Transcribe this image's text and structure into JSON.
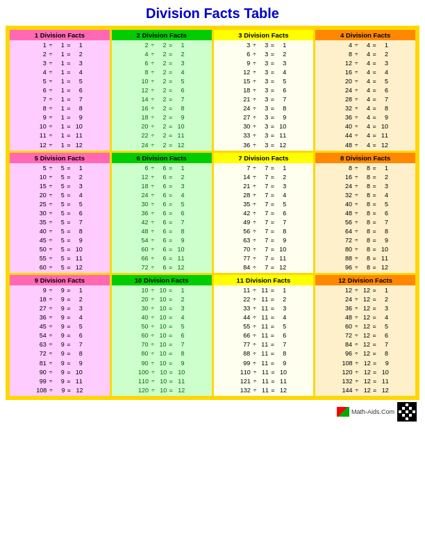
{
  "title": "Division Facts Table",
  "sections": [
    {
      "id": 1,
      "label": "1 Division Facts",
      "class": "s1",
      "divisor": 1,
      "facts": [
        [
          1,
          1,
          1
        ],
        [
          2,
          1,
          2
        ],
        [
          3,
          1,
          3
        ],
        [
          4,
          1,
          4
        ],
        [
          5,
          1,
          5
        ],
        [
          6,
          1,
          6
        ],
        [
          7,
          1,
          7
        ],
        [
          8,
          1,
          8
        ],
        [
          9,
          1,
          9
        ],
        [
          10,
          1,
          10
        ],
        [
          11,
          1,
          11
        ],
        [
          12,
          1,
          12
        ]
      ]
    },
    {
      "id": 2,
      "label": "2 Division Facts",
      "class": "s2",
      "divisor": 2,
      "facts": [
        [
          2,
          2,
          1
        ],
        [
          4,
          2,
          2
        ],
        [
          6,
          2,
          3
        ],
        [
          8,
          2,
          4
        ],
        [
          10,
          2,
          5
        ],
        [
          12,
          2,
          6
        ],
        [
          14,
          2,
          7
        ],
        [
          16,
          2,
          8
        ],
        [
          18,
          2,
          9
        ],
        [
          20,
          2,
          10
        ],
        [
          22,
          2,
          11
        ],
        [
          24,
          2,
          12
        ]
      ]
    },
    {
      "id": 3,
      "label": "3 Division Facts",
      "class": "s3",
      "divisor": 3,
      "facts": [
        [
          3,
          3,
          1
        ],
        [
          6,
          3,
          2
        ],
        [
          9,
          3,
          3
        ],
        [
          12,
          3,
          4
        ],
        [
          15,
          3,
          5
        ],
        [
          18,
          3,
          6
        ],
        [
          21,
          3,
          7
        ],
        [
          24,
          3,
          8
        ],
        [
          27,
          3,
          9
        ],
        [
          30,
          3,
          10
        ],
        [
          33,
          3,
          11
        ],
        [
          36,
          3,
          12
        ]
      ]
    },
    {
      "id": 4,
      "label": "4 Division Facts",
      "class": "s4",
      "divisor": 4,
      "facts": [
        [
          4,
          4,
          1
        ],
        [
          8,
          4,
          2
        ],
        [
          12,
          4,
          3
        ],
        [
          16,
          4,
          4
        ],
        [
          20,
          4,
          5
        ],
        [
          24,
          4,
          6
        ],
        [
          28,
          4,
          7
        ],
        [
          32,
          4,
          8
        ],
        [
          36,
          4,
          9
        ],
        [
          40,
          4,
          10
        ],
        [
          44,
          4,
          11
        ],
        [
          48,
          4,
          12
        ]
      ]
    },
    {
      "id": 5,
      "label": "5 Division Facts",
      "class": "s5",
      "divisor": 5,
      "facts": [
        [
          5,
          5,
          1
        ],
        [
          10,
          5,
          2
        ],
        [
          15,
          5,
          3
        ],
        [
          20,
          5,
          4
        ],
        [
          25,
          5,
          5
        ],
        [
          30,
          5,
          6
        ],
        [
          35,
          5,
          7
        ],
        [
          40,
          5,
          8
        ],
        [
          45,
          5,
          9
        ],
        [
          50,
          5,
          10
        ],
        [
          55,
          5,
          11
        ],
        [
          60,
          5,
          12
        ]
      ]
    },
    {
      "id": 6,
      "label": "6 Division Facts",
      "class": "s6",
      "divisor": 6,
      "facts": [
        [
          6,
          6,
          1
        ],
        [
          12,
          6,
          2
        ],
        [
          18,
          6,
          3
        ],
        [
          24,
          6,
          4
        ],
        [
          30,
          6,
          5
        ],
        [
          36,
          6,
          6
        ],
        [
          42,
          6,
          7
        ],
        [
          48,
          6,
          8
        ],
        [
          54,
          6,
          9
        ],
        [
          60,
          6,
          10
        ],
        [
          66,
          6,
          11
        ],
        [
          72,
          6,
          12
        ]
      ]
    },
    {
      "id": 7,
      "label": "7 Division Facts",
      "class": "s7",
      "divisor": 7,
      "facts": [
        [
          7,
          7,
          1
        ],
        [
          14,
          7,
          2
        ],
        [
          21,
          7,
          3
        ],
        [
          28,
          7,
          4
        ],
        [
          35,
          7,
          5
        ],
        [
          42,
          7,
          6
        ],
        [
          49,
          7,
          7
        ],
        [
          56,
          7,
          8
        ],
        [
          63,
          7,
          9
        ],
        [
          70,
          7,
          10
        ],
        [
          77,
          7,
          11
        ],
        [
          84,
          7,
          12
        ]
      ]
    },
    {
      "id": 8,
      "label": "8 Division Facts",
      "class": "s8",
      "divisor": 8,
      "facts": [
        [
          8,
          8,
          1
        ],
        [
          16,
          8,
          2
        ],
        [
          24,
          8,
          3
        ],
        [
          32,
          8,
          4
        ],
        [
          40,
          8,
          5
        ],
        [
          48,
          8,
          6
        ],
        [
          56,
          8,
          7
        ],
        [
          64,
          8,
          8
        ],
        [
          72,
          8,
          9
        ],
        [
          80,
          8,
          10
        ],
        [
          88,
          8,
          11
        ],
        [
          96,
          8,
          12
        ]
      ]
    },
    {
      "id": 9,
      "label": "9 Division Facts",
      "class": "s9",
      "divisor": 9,
      "facts": [
        [
          9,
          9,
          1
        ],
        [
          18,
          9,
          2
        ],
        [
          27,
          9,
          3
        ],
        [
          36,
          9,
          4
        ],
        [
          45,
          9,
          5
        ],
        [
          54,
          9,
          6
        ],
        [
          63,
          9,
          7
        ],
        [
          72,
          9,
          8
        ],
        [
          81,
          9,
          9
        ],
        [
          90,
          9,
          10
        ],
        [
          99,
          9,
          11
        ],
        [
          108,
          9,
          12
        ]
      ]
    },
    {
      "id": 10,
      "label": "10 Division Facts",
      "class": "s10",
      "divisor": 10,
      "facts": [
        [
          10,
          10,
          1
        ],
        [
          20,
          10,
          2
        ],
        [
          30,
          10,
          3
        ],
        [
          40,
          10,
          4
        ],
        [
          50,
          10,
          5
        ],
        [
          60,
          10,
          6
        ],
        [
          70,
          10,
          7
        ],
        [
          80,
          10,
          8
        ],
        [
          90,
          10,
          9
        ],
        [
          100,
          10,
          10
        ],
        [
          110,
          10,
          11
        ],
        [
          120,
          10,
          12
        ]
      ]
    },
    {
      "id": 11,
      "label": "11 Division Facts",
      "class": "s11",
      "divisor": 11,
      "facts": [
        [
          11,
          11,
          1
        ],
        [
          22,
          11,
          2
        ],
        [
          33,
          11,
          3
        ],
        [
          44,
          11,
          4
        ],
        [
          55,
          11,
          5
        ],
        [
          66,
          11,
          6
        ],
        [
          77,
          11,
          7
        ],
        [
          88,
          11,
          8
        ],
        [
          99,
          11,
          9
        ],
        [
          110,
          11,
          10
        ],
        [
          121,
          11,
          11
        ],
        [
          132,
          11,
          12
        ]
      ]
    },
    {
      "id": 12,
      "label": "12 Division Facts",
      "class": "s12",
      "divisor": 12,
      "facts": [
        [
          12,
          12,
          1
        ],
        [
          24,
          12,
          2
        ],
        [
          36,
          12,
          3
        ],
        [
          48,
          12,
          4
        ],
        [
          60,
          12,
          5
        ],
        [
          72,
          12,
          6
        ],
        [
          84,
          12,
          7
        ],
        [
          96,
          12,
          8
        ],
        [
          108,
          12,
          9
        ],
        [
          120,
          12,
          10
        ],
        [
          132,
          12,
          11
        ],
        [
          144,
          12,
          12
        ]
      ]
    }
  ],
  "footer_text": "Math-Aids.Com"
}
